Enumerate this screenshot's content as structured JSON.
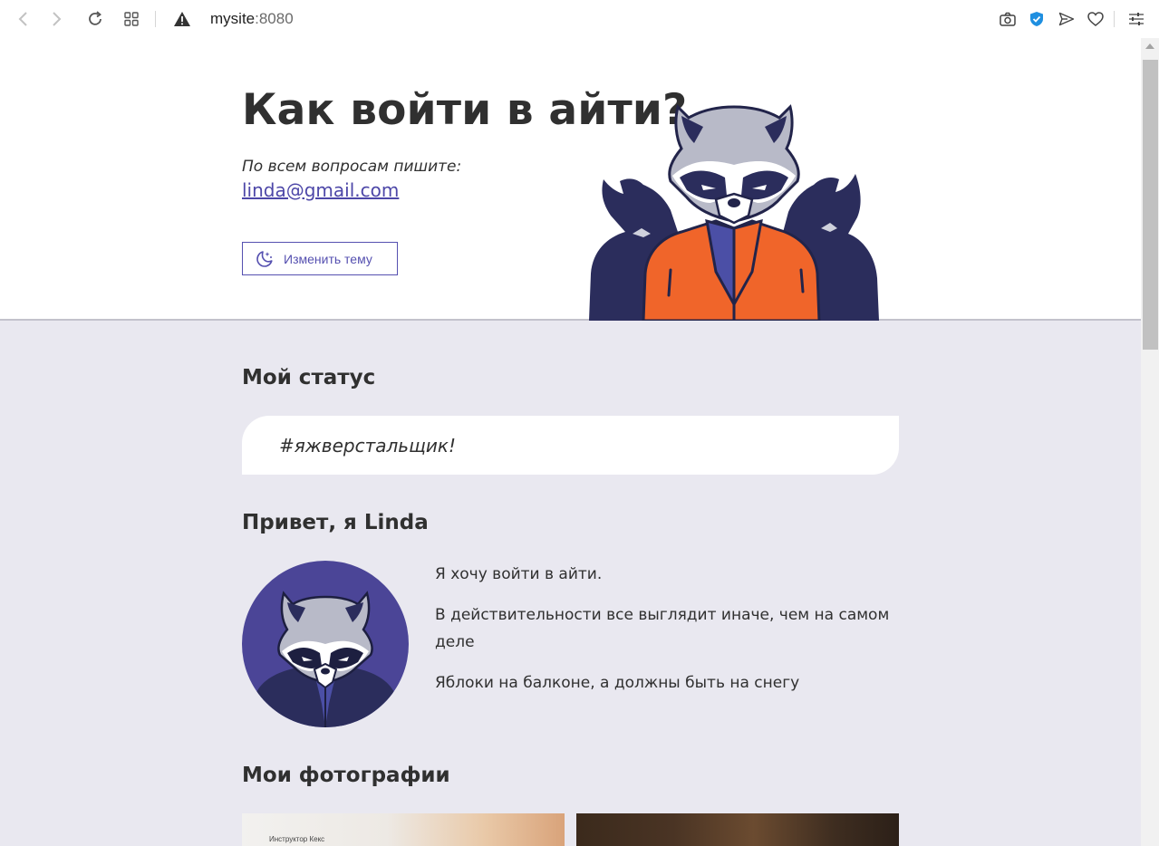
{
  "browser": {
    "url_host": "mysite",
    "url_port": ":8080",
    "icons": [
      "back-icon",
      "forward-icon",
      "reload-icon",
      "tabs-grid-icon",
      "warning-icon",
      "camera-icon",
      "shield-icon",
      "send-icon",
      "heart-icon",
      "settings-sliders-icon"
    ]
  },
  "hero": {
    "title": "Как войти в айти?",
    "contact_text": "По всем вопросам пишите:",
    "email": "linda@gmail.com",
    "theme_button_label": "Изменить тему"
  },
  "status": {
    "heading": "Мой статус",
    "value": "#яжверстальщик!"
  },
  "about": {
    "heading": "Привет, я Linda",
    "paragraphs": [
      "Я хочу войти в айти.",
      "В действительности все выглядит иначе, чем на самом деле",
      "Яблоки на балконе, а должны быть на снегу"
    ]
  },
  "photos": {
    "heading": "Мои фотографии",
    "first_caption": "Инструктор Кекс"
  },
  "colors": {
    "accent": "#5550b0",
    "page_background": "#e9e8f0",
    "jacket_orange": "#f0652a",
    "raccoon_dark": "#2b2d5c"
  }
}
